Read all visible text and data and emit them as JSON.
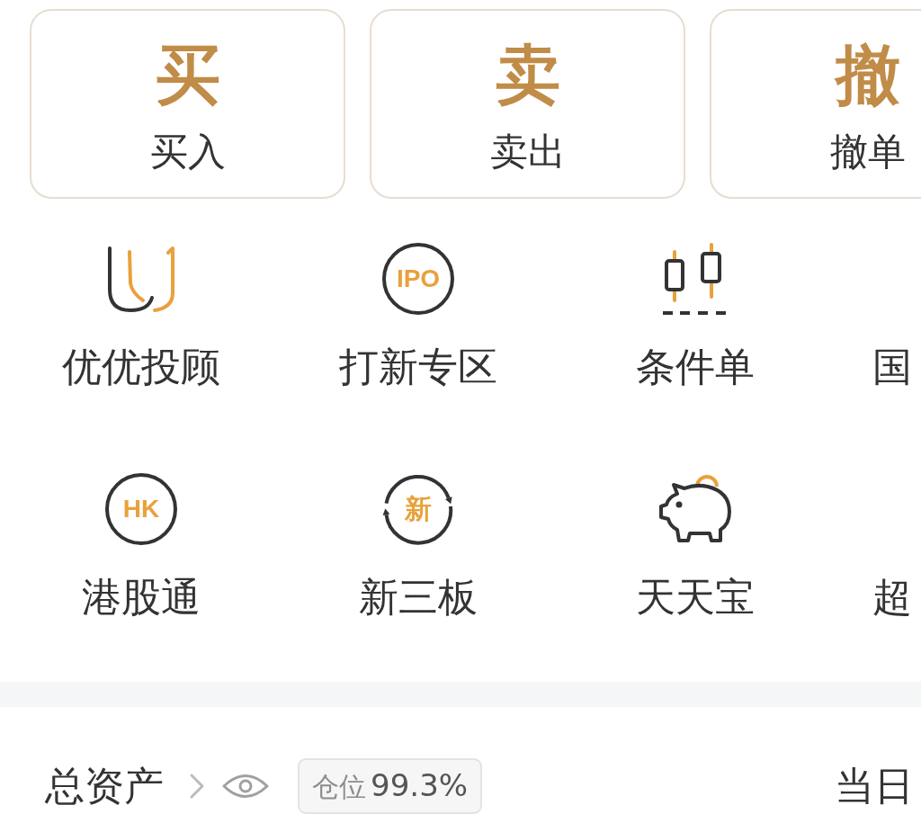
{
  "trade_actions": [
    {
      "glyph": "买",
      "label": "买入"
    },
    {
      "glyph": "卖",
      "label": "卖出"
    },
    {
      "glyph": "撤",
      "label": "撤单"
    }
  ],
  "shortcut_rows": [
    [
      {
        "kind": "logo",
        "label": "优优投顾"
      },
      {
        "kind": "ring",
        "icon_text": "IPO",
        "label": "打新专区"
      },
      {
        "kind": "candles",
        "label": "条件单"
      },
      {
        "kind": "cut",
        "label": "国"
      }
    ],
    [
      {
        "kind": "ring",
        "icon_text": "HK",
        "label": "港股通"
      },
      {
        "kind": "cycle",
        "icon_text": "新",
        "label": "新三板"
      },
      {
        "kind": "piggy",
        "label": "天天宝"
      },
      {
        "kind": "cut",
        "label": "超"
      }
    ]
  ],
  "assets": {
    "title": "总资产",
    "position_badge": {
      "label": "仓位",
      "value": "99.3%"
    },
    "right_label": "当日"
  }
}
